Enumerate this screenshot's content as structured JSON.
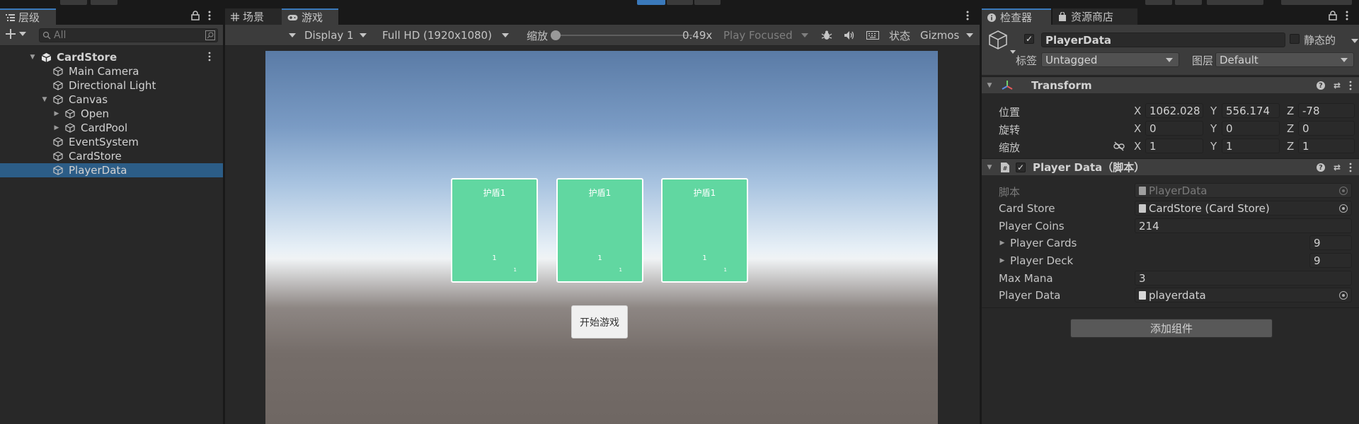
{
  "hierarchy": {
    "tab_label": "层级",
    "search_placeholder": "All",
    "items": [
      {
        "label": "CardStore",
        "depth": 0,
        "icon": "unity-scene-icon",
        "foldout": "open",
        "bold": true
      },
      {
        "label": "Main Camera",
        "depth": 1,
        "icon": "cube-icon",
        "foldout": "none"
      },
      {
        "label": "Directional Light",
        "depth": 1,
        "icon": "cube-icon",
        "foldout": "none"
      },
      {
        "label": "Canvas",
        "depth": 1,
        "icon": "cube-icon",
        "foldout": "open"
      },
      {
        "label": "Open",
        "depth": 2,
        "icon": "cube-icon",
        "foldout": "closed"
      },
      {
        "label": "CardPool",
        "depth": 2,
        "icon": "cube-icon",
        "foldout": "closed"
      },
      {
        "label": "EventSystem",
        "depth": 1,
        "icon": "cube-icon",
        "foldout": "none"
      },
      {
        "label": "CardStore",
        "depth": 1,
        "icon": "cube-icon",
        "foldout": "none"
      },
      {
        "label": "PlayerData",
        "depth": 1,
        "icon": "cube-icon",
        "foldout": "none",
        "selected": true
      }
    ]
  },
  "game_view": {
    "tabs": [
      {
        "label": "场景",
        "icon": "grid-icon",
        "active": false
      },
      {
        "label": "游戏",
        "icon": "gamepad-icon",
        "active": true
      }
    ],
    "toolbar": {
      "display": "Display 1",
      "resolution": "Full HD (1920x1080)",
      "scale_label": "缩放",
      "scale_value": "0.49x",
      "scale_fraction": 0.0,
      "play_focused": "Play Focused",
      "stats_label": "状态",
      "gizmos_label": "Gizmos"
    },
    "cards": [
      {
        "title": "护盾1",
        "num": "1",
        "small": "1"
      },
      {
        "title": "护盾1",
        "num": "1",
        "small": "1"
      },
      {
        "title": "护盾1",
        "num": "1",
        "small": "1"
      }
    ],
    "start_button": "开始游戏"
  },
  "inspector": {
    "tabs": [
      {
        "label": "检查器",
        "icon": "info-icon",
        "active": true
      },
      {
        "label": "资源商店",
        "icon": "store-icon",
        "active": false
      }
    ],
    "object_name": "PlayerData",
    "active": true,
    "static_label": "静态的",
    "tag_label": "标签",
    "tag_value": "Untagged",
    "layer_label": "图层",
    "layer_value": "Default",
    "transform": {
      "title": "Transform",
      "position_label": "位置",
      "rotation_label": "旋转",
      "scale_label": "缩放",
      "position": {
        "x": "1062.028",
        "y": "556.174",
        "z": "-78"
      },
      "rotation": {
        "x": "0",
        "y": "0",
        "z": "0"
      },
      "scale": {
        "x": "1",
        "y": "1",
        "z": "1"
      }
    },
    "player_data_component": {
      "title": "Player Data（脚本）",
      "enabled": true,
      "props": {
        "script_label": "脚本",
        "script_value": "PlayerData",
        "card_store_label": "Card Store",
        "card_store_value": "CardStore (Card Store)",
        "player_coins_label": "Player Coins",
        "player_coins_value": "214",
        "player_cards_label": "Player Cards",
        "player_cards_value": "9",
        "player_deck_label": "Player Deck",
        "player_deck_value": "9",
        "max_mana_label": "Max Mana",
        "max_mana_value": "3",
        "player_data_label": "Player Data",
        "player_data_value": "playerdata"
      }
    },
    "add_component": "添加组件"
  },
  "colors": {
    "accent": "#3a79bb",
    "selected_row": "#2c5d87",
    "card": "#61d7a1"
  }
}
